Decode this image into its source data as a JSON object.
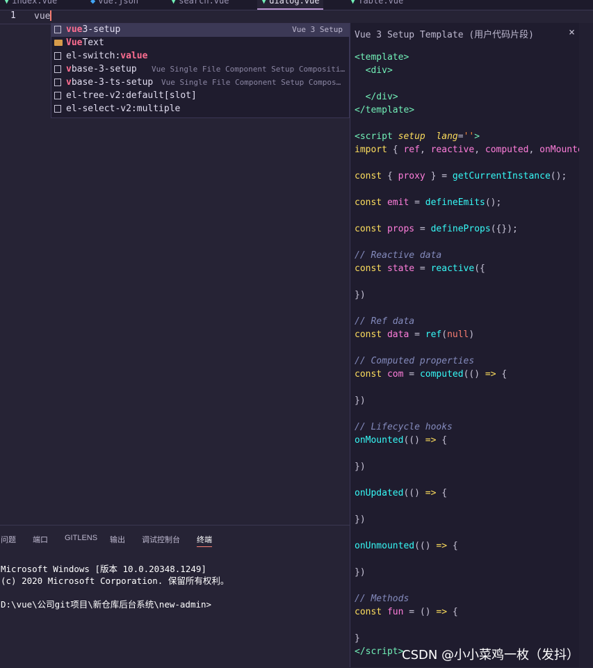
{
  "tabs": [
    {
      "label": "index.vue"
    },
    {
      "label": "vue.json"
    },
    {
      "label": "search.vue"
    },
    {
      "label": "dialog.vue"
    },
    {
      "label": "Table.vue"
    }
  ],
  "editor": {
    "line_number": "1",
    "typed": "vue"
  },
  "suggestions": [
    {
      "match": "vue",
      "rest": "3-setup",
      "detail": "Vue 3 Setup",
      "icon": "snippet-icon"
    },
    {
      "match": "Vue",
      "rest": "Text",
      "detail": "",
      "icon": "folder-icon"
    },
    {
      "label": "el-switch:",
      "match2": "v",
      "rest": "alue",
      "detail": "",
      "icon": "snippet-icon"
    },
    {
      "match": "v",
      "label": "base-3-setup",
      "detail": "Vue Single File Component Setup Compositi…",
      "icon": "snippet-icon"
    },
    {
      "match": "v",
      "label": "base-3-ts-setup",
      "detail": "Vue Single File Component Setup Compos…",
      "icon": "snippet-icon"
    },
    {
      "label": "el-tree-v2:default[slot]",
      "detail": "",
      "icon": "snippet-icon"
    },
    {
      "label": "el-select-v2:multiple",
      "detail": "",
      "icon": "snippet-icon"
    }
  ],
  "details": {
    "title": "Vue 3 Setup Template (用户代码片段)",
    "close": "×"
  },
  "panel": {
    "tabs": [
      "问题",
      "端口",
      "GITLENS",
      "输出",
      "调试控制台",
      "终端"
    ],
    "terminal_lines": [
      "Microsoft Windows [版本 10.0.20348.1249]",
      "(c) 2020 Microsoft Corporation. 保留所有权利。",
      "",
      "D:\\vue\\公司git项目\\新仓库后台系统\\new-admin>"
    ]
  },
  "watermark": "CSDN @小小菜鸡一枚（发抖）",
  "colors": {
    "background": "#262335",
    "tag": "#72f1b8",
    "keyword": "#fede5d",
    "function": "#36f9f6",
    "variable": "#ff7edb",
    "comment": "#848bbd"
  }
}
